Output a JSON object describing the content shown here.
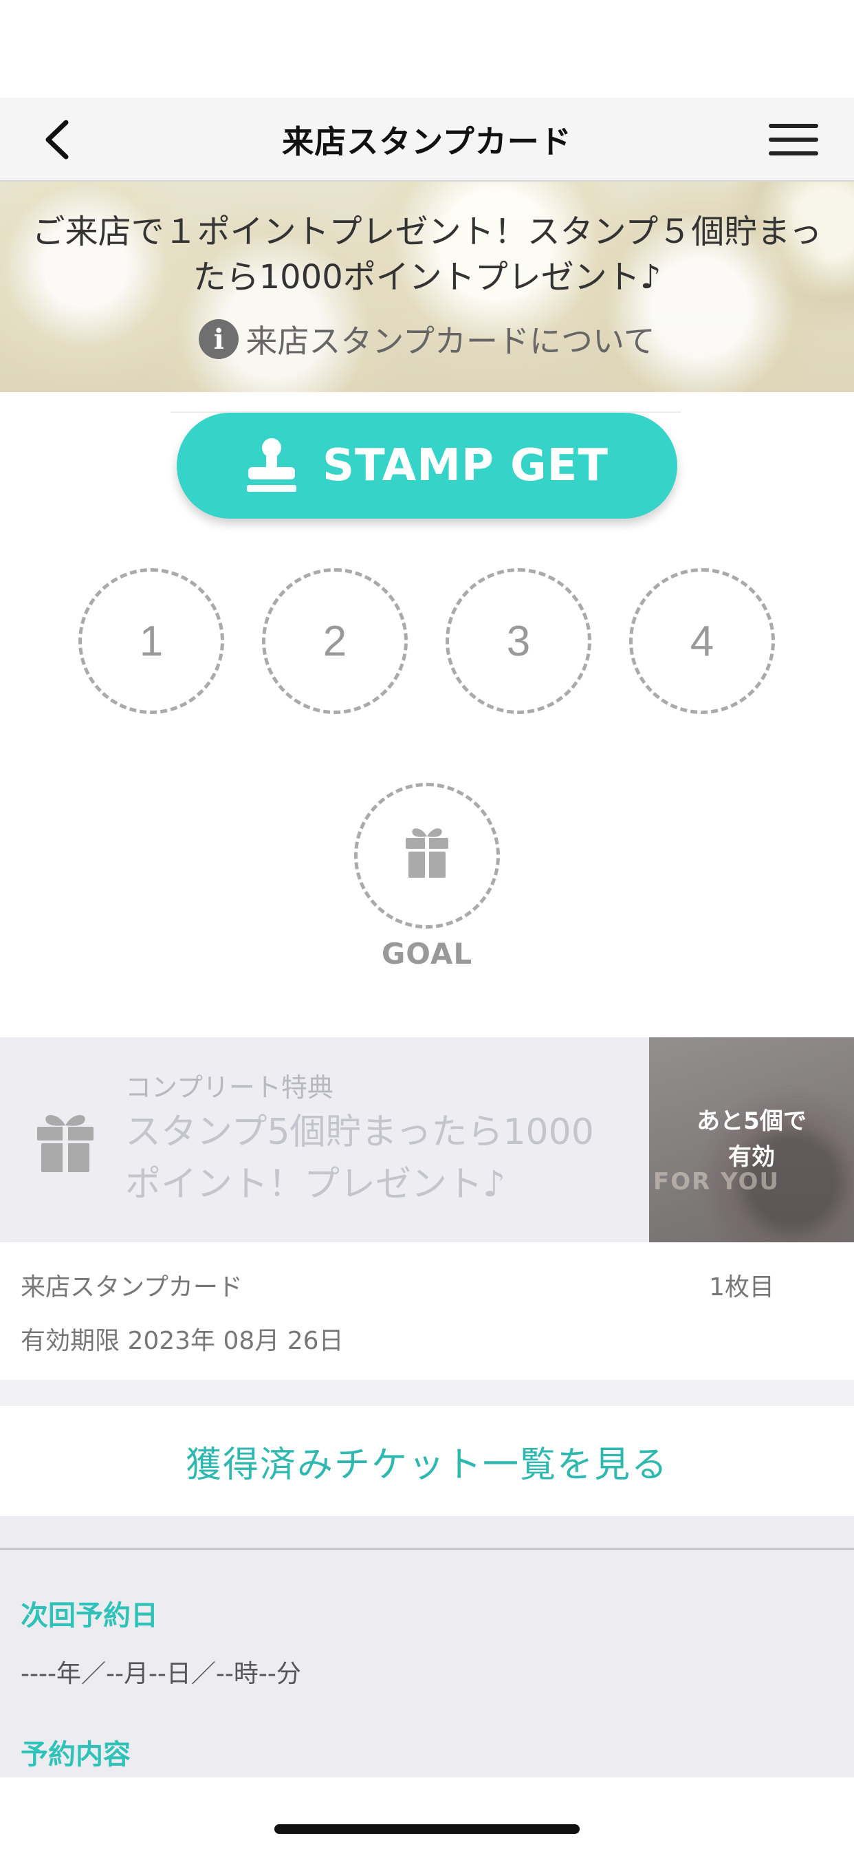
{
  "nav": {
    "title": "来店スタンプカード",
    "back_icon": "chevron-left-icon",
    "menu_icon": "hamburger-menu-icon"
  },
  "banner": {
    "message": "ご来店で１ポイントプレゼント！スタンプ５個貯まったら1000ポイントプレゼント♪",
    "info_link": "来店スタンプカードについて",
    "info_icon": "info-icon"
  },
  "stamp_button": {
    "label": "STAMP GET",
    "icon": "stamp-icon",
    "color": "#36d3c8"
  },
  "stamps": {
    "slots": [
      "1",
      "2",
      "3",
      "4"
    ],
    "goal_label": "GOAL",
    "goal_icon": "gift-icon"
  },
  "reward": {
    "caption": "コンプリート特典",
    "description": "スタンプ5個貯まったら1000ポイント！プレゼント♪",
    "remaining_line1": "あと5個で",
    "remaining_line2": "有効",
    "thumb_text": "FOR YOU"
  },
  "card": {
    "name": "来店スタンプカード",
    "count": "1枚目",
    "expiry": "有効期限 2023年 08月 26日"
  },
  "tickets_link": "獲得済みチケット一覧を見る",
  "reservation": {
    "next_label": "次回予約日",
    "next_value": "----年／--月--日／--時--分",
    "detail_label": "予約内容"
  },
  "colors": {
    "accent": "#36d3c8",
    "link": "#2fb8b0"
  }
}
